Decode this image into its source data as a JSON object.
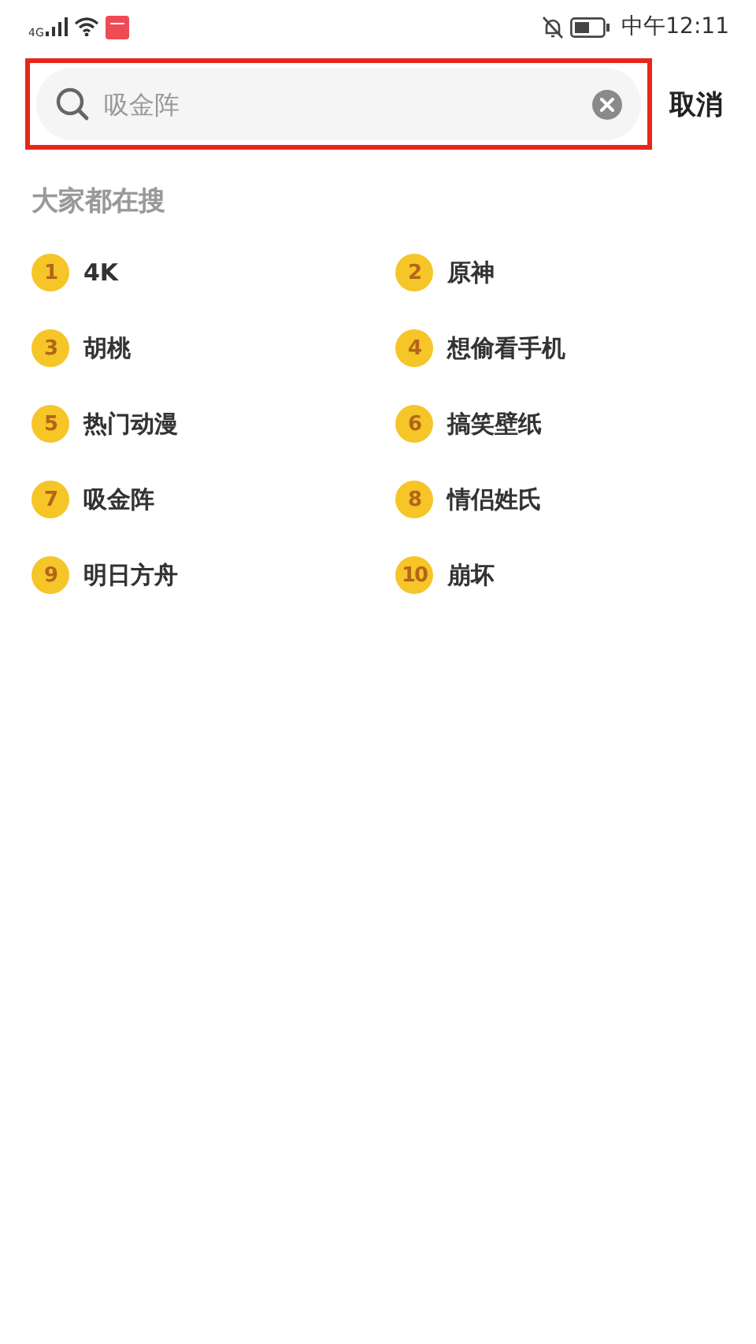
{
  "status_bar": {
    "network": "4G",
    "time": "中午12:11"
  },
  "search": {
    "placeholder": "吸金阵",
    "cancel": "取消"
  },
  "section_title": "大家都在搜",
  "hot_searches": [
    {
      "rank": "1",
      "label": "4K"
    },
    {
      "rank": "2",
      "label": "原神"
    },
    {
      "rank": "3",
      "label": "胡桃"
    },
    {
      "rank": "4",
      "label": "想偷看手机"
    },
    {
      "rank": "5",
      "label": "热门动漫"
    },
    {
      "rank": "6",
      "label": "搞笑壁纸"
    },
    {
      "rank": "7",
      "label": "吸金阵"
    },
    {
      "rank": "8",
      "label": "情侣姓氏"
    },
    {
      "rank": "9",
      "label": "明日方舟"
    },
    {
      "rank": "10",
      "label": "崩坏"
    }
  ]
}
